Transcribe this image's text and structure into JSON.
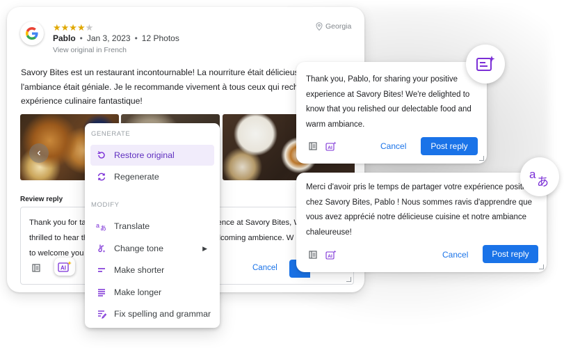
{
  "review": {
    "stars_filled": 4,
    "stars_total": 5,
    "author": "Pablo",
    "date": "Jan 3, 2023",
    "photo_count": "12 Photos",
    "view_original": "View original in French",
    "location": "Georgia",
    "text": "Savory Bites est un restaurant incontournable! La nourriture était délicieuse et l'ambiance était géniale. Je le recommande vivement à tous ceux qui recherchent une expérience culinaire fantastique!"
  },
  "review_reply": {
    "label": "Review reply",
    "text": "Thank you for ta... rience at Savory Bites, We're\nthrilled to hear th... welcoming ambience. We look forward\nto welcome you ...",
    "text_lines": [
      "Thank you for ta",
      "thrilled to hear th",
      "to welcome you"
    ],
    "text_lines_right": [
      "erience at Savory Bites, W",
      "welcoming ambience. W",
      ""
    ],
    "cancel_label": "Cancel",
    "ai_label": "AI"
  },
  "menu": {
    "section_generate": "GENERATE",
    "section_modify": "MODIFY",
    "items_generate": [
      {
        "label": "Restore original",
        "icon": "restore-icon"
      },
      {
        "label": "Regenerate",
        "icon": "regenerate-icon"
      }
    ],
    "items_modify": [
      {
        "label": "Translate",
        "icon": "translate-icon"
      },
      {
        "label": "Change tone",
        "icon": "tone-icon"
      },
      {
        "label": "Make shorter",
        "icon": "shorter-icon"
      },
      {
        "label": "Make longer",
        "icon": "longer-icon"
      },
      {
        "label": "Fix spelling and grammar",
        "icon": "spellcheck-icon"
      }
    ]
  },
  "reply_english": {
    "text": "Thank you, Pablo, for sharing your positive experience at Savory Bites! We're delighted to know that you relished our delectable food and warm ambiance.",
    "cancel_label": "Cancel",
    "post_label": "Post reply"
  },
  "reply_french": {
    "text": "Merci d'avoir pris le temps de partager votre expérience positive chez Savory Bites, Pablo ! Nous sommes ravis d'apprendre que vous avez apprécié notre délicieuse cuisine et notre ambiance chaleureuse!",
    "cancel_label": "Cancel",
    "post_label": "Post reply"
  },
  "colors": {
    "accent_blue": "#1a73e8",
    "accent_purple": "#7b2fd6",
    "star": "#e0a800"
  }
}
